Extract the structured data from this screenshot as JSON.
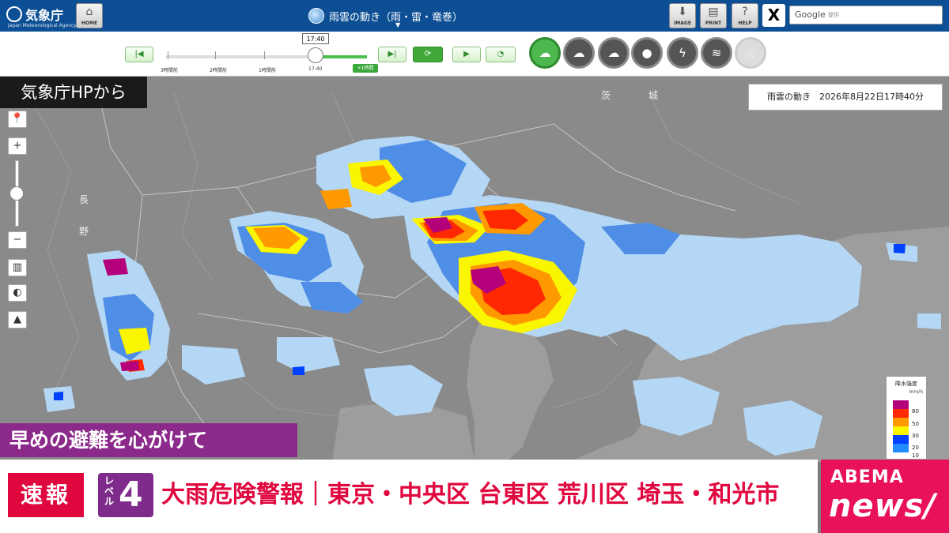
{
  "header": {
    "agency_name": "気象庁",
    "agency_name_en": "Japan Meteorological Agency",
    "home_label": "HOME",
    "page_title": "雨雲の動き（雨・雷・竜巻）",
    "image_label": "IMAGE",
    "print_label": "PRINT",
    "help_label": "HELP",
    "x_label": "X",
    "search_brand": "Google",
    "search_suffix": "提供"
  },
  "controls": {
    "current_time": "17:40",
    "time_labels": [
      "3時間前",
      "2時間前",
      "1時間前",
      "17:40"
    ],
    "forecast_label": "+1時間",
    "layers": [
      "rain-cloud-icon",
      "thunder-cloud-icon",
      "tornado-icon",
      "rain-drop-icon",
      "lightning-icon",
      "wind-icon",
      "disabled-icon"
    ]
  },
  "map": {
    "watermark": "NEWS",
    "source_caption": "気象庁HPから",
    "timestamp": "雨雲の動き　2026年8月22日17時40分",
    "place_labels": [
      "長",
      "野",
      "茨",
      "城"
    ]
  },
  "legend": {
    "title": "降水強度",
    "unit": "mm/h",
    "values": [
      "80",
      "50",
      "30",
      "20",
      "10"
    ],
    "colors": {
      "80": "#b4007b",
      "50": "#ff2800",
      "30": "#ff9900",
      "20": "#faf500",
      "10": "#0041ff",
      "5": "#218cff"
    }
  },
  "ticker": {
    "advice": "早めの避難を心がけて",
    "tag": "速報",
    "level_label": "レベル",
    "level_value": "4",
    "alert": "大雨危険警報｜東京・中央区 台東区 荒川区 埼玉・和光市",
    "brand_top": "ABEMA",
    "brand_bottom": "news/"
  }
}
